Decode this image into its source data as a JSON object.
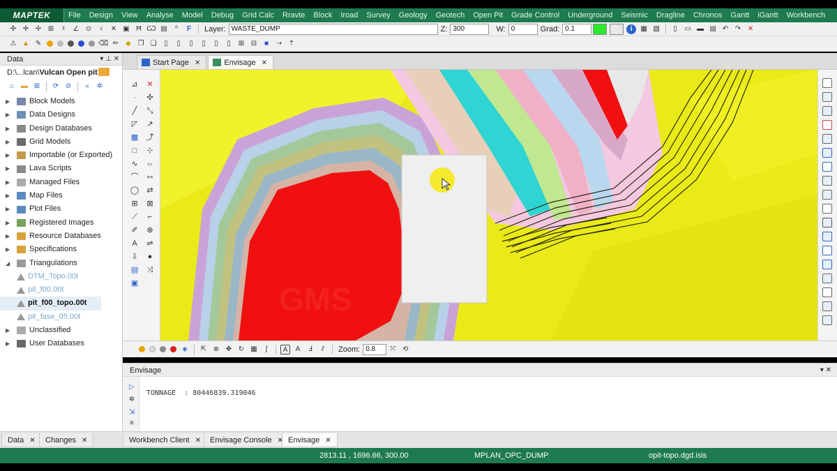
{
  "app": {
    "logo": "MAPTEK",
    "menu": [
      "File",
      "Design",
      "View",
      "Analyse",
      "Model",
      "Debug",
      "Grid Calc",
      "Rravte",
      "Block",
      "Iroad",
      "Survey",
      "Geology",
      "Geotech",
      "Open Pit",
      "Grade Control",
      "Underground",
      "Seismic",
      "Dragline",
      "Chronos",
      "Gantt",
      "iGantt",
      "Workbench"
    ]
  },
  "toolbar": {
    "layer_label": "Layer:",
    "layer_value": "WASTE_DUMP",
    "z_label": "Z:",
    "z_value": "300",
    "w_label": "W:",
    "w_value": "0",
    "grad_label": "Grad:",
    "grad_value": "0.1",
    "swatch_color": "#2ee82e"
  },
  "data_panel": {
    "title": "Data",
    "path_prefix": "D:\\...lcan\\",
    "path_bold": "Vulcan Open pit",
    "tree": [
      {
        "label": "Block Models",
        "icon": "block-model-icon",
        "color": "#7a86a8"
      },
      {
        "label": "Data Designs",
        "icon": "design-icon",
        "color": "#6b8fb5"
      },
      {
        "label": "Design Databases",
        "icon": "database-icon",
        "color": "#8a8a8a"
      },
      {
        "label": "Grid Models",
        "icon": "grid-icon",
        "color": "#6a6a6a"
      },
      {
        "label": "Importable (or Exported)",
        "icon": "import-icon",
        "color": "#c49a4a"
      },
      {
        "label": "Lava Scripts",
        "icon": "script-icon",
        "color": "#8a8a8a"
      },
      {
        "label": "Managed Files",
        "icon": "file-icon",
        "color": "#aaaaaa"
      },
      {
        "label": "Map Files",
        "icon": "map-icon",
        "color": "#5a8ac0"
      },
      {
        "label": "Plot Files",
        "icon": "plot-icon",
        "color": "#5a8ac0"
      },
      {
        "label": "Registered Images",
        "icon": "image-icon",
        "color": "#7aa060"
      },
      {
        "label": "Resource Databases",
        "icon": "folder-icon",
        "color": "#d9a23a"
      },
      {
        "label": "Specifications",
        "icon": "folder-icon",
        "color": "#d9a23a"
      },
      {
        "label": "Triangulations",
        "icon": "triangle-icon",
        "color": "#999999",
        "expanded": true
      }
    ],
    "triangulations": [
      {
        "label": "DTM_Topo.00t"
      },
      {
        "label": "pit_f00.00t"
      },
      {
        "label": "pit_f00_topo.00t",
        "selected": true
      },
      {
        "label": "pit_fase_05.00t"
      }
    ],
    "tree_after": [
      {
        "label": "Unclassified",
        "icon": "doc-icon",
        "color": "#aaaaaa"
      },
      {
        "label": "User Databases",
        "icon": "database-icon",
        "color": "#6a6a6a"
      }
    ]
  },
  "doc_tabs": [
    {
      "label": "Start Page",
      "icon": "home-icon"
    },
    {
      "label": "Envisage",
      "icon": "envisage-icon",
      "active": true
    }
  ],
  "viewport": {
    "zoom_label": "Zoom:",
    "zoom_value": "0.8",
    "watermark": "GMS"
  },
  "lower_panel": {
    "title": "Envisage",
    "output": "TONNAGE  : 80446839.319046"
  },
  "bottom_tabs": [
    {
      "label": "Data"
    },
    {
      "label": "Changes"
    },
    {
      "label": "Workbench Client"
    },
    {
      "label": "Envisage Console"
    },
    {
      "label": "Envisage",
      "active": true
    }
  ],
  "status": {
    "coords": "2813.11 , 1696.66, 300.00",
    "layer": "MPLAN_OPC_DUMP",
    "file": "opit-topo.dgd.isis"
  }
}
